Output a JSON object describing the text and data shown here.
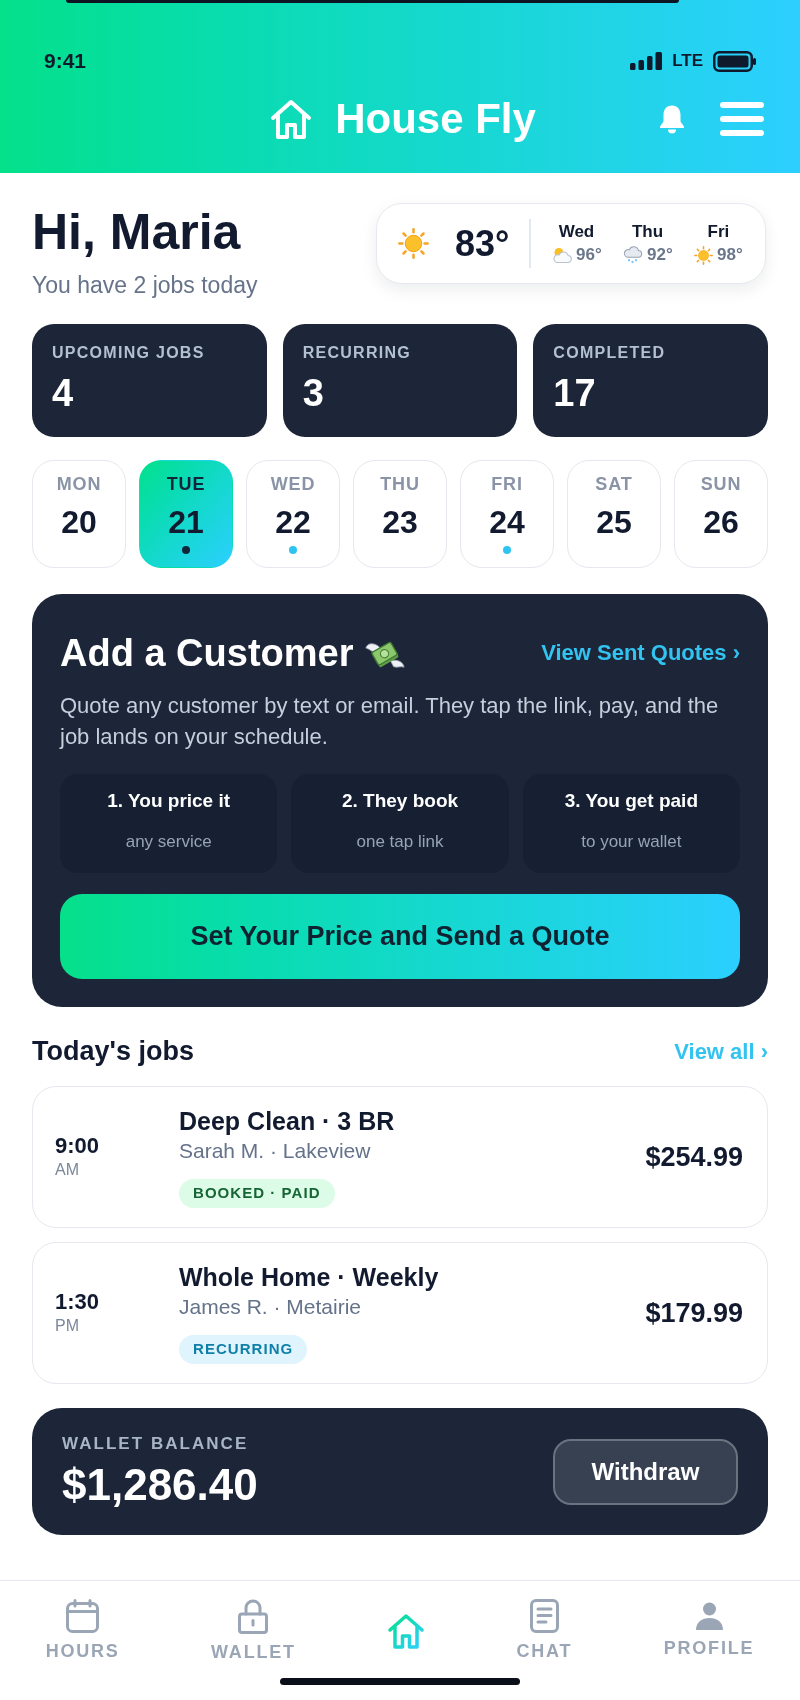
{
  "status_bar": {
    "time": "9:41",
    "network": "LTE"
  },
  "header": {
    "title": "House Fly"
  },
  "greeting": {
    "title": "Hi, Maria",
    "subtitle": "You have 2 jobs today"
  },
  "weather": {
    "temperature": "83°",
    "forecast": [
      {
        "day": "Wed",
        "kind": "cloudy",
        "temperature": "96°"
      },
      {
        "day": "Thu",
        "kind": "rain",
        "temperature": "92°"
      },
      {
        "day": "Fri",
        "kind": "sunny",
        "temperature": "98°"
      }
    ]
  },
  "stats": [
    {
      "label": "UPCOMING JOBS",
      "value": "4"
    },
    {
      "label": "RECURRING",
      "value": "3"
    },
    {
      "label": "COMPLETED",
      "value": "17"
    }
  ],
  "days": [
    {
      "weekday": "MON",
      "date": "20",
      "selected": false,
      "has_jobs": false
    },
    {
      "weekday": "TUE",
      "date": "21",
      "selected": true,
      "has_jobs": true
    },
    {
      "weekday": "WED",
      "date": "22",
      "selected": false,
      "has_jobs": true
    },
    {
      "weekday": "THU",
      "date": "23",
      "selected": false,
      "has_jobs": false
    },
    {
      "weekday": "FRI",
      "date": "24",
      "selected": false,
      "has_jobs": true
    },
    {
      "weekday": "SAT",
      "date": "25",
      "selected": false,
      "has_jobs": false
    },
    {
      "weekday": "SUN",
      "date": "26",
      "selected": false,
      "has_jobs": false
    }
  ],
  "quote_card": {
    "title": "Add a Customer",
    "link": "View Sent Quotes ›",
    "description": "Quote any customer by text or email. They tap the link, pay, and the job lands on your schedule.",
    "steps": [
      {
        "title": "1. You price it",
        "subtitle": "any service"
      },
      {
        "title": "2. They book",
        "subtitle": "one tap link"
      },
      {
        "title": "3. You get paid",
        "subtitle": "to your wallet"
      }
    ],
    "button": "Set Your Price and Send a Quote"
  },
  "todays_jobs": {
    "title": "Today's jobs",
    "link": "View all ›",
    "jobs": [
      {
        "time": "9:00",
        "period": "AM",
        "title": "Deep Clean · 3 BR",
        "client": "Sarah M. · Lakeview",
        "badge": "BOOKED · PAID",
        "kind": "paid",
        "price": "$254.99"
      },
      {
        "time": "1:30",
        "period": "PM",
        "title": "Whole Home · Weekly",
        "client": "James R. · Metairie",
        "badge": "RECURRING",
        "kind": "recurring",
        "price": "$179.99"
      }
    ]
  },
  "wallet": {
    "label": "WALLET BALANCE",
    "balance": "$1,286.40",
    "button": "Withdraw"
  },
  "bottom_nav": [
    {
      "label": "HOURS",
      "selected": false
    },
    {
      "label": "WALLET",
      "selected": false
    },
    {
      "selected": true
    },
    {
      "label": "CHAT",
      "selected": false
    },
    {
      "label": "PROFILE",
      "selected": false
    }
  ]
}
